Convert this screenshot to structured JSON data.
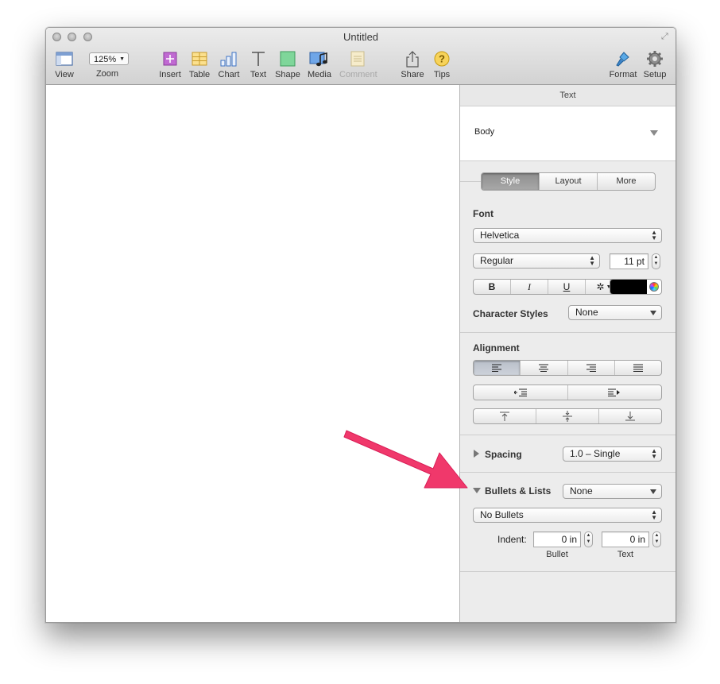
{
  "window": {
    "title": "Untitled"
  },
  "toolbar": {
    "view_label": "View",
    "zoom_value": "125%",
    "zoom_label": "Zoom",
    "insert_label": "Insert",
    "table_label": "Table",
    "chart_label": "Chart",
    "text_label": "Text",
    "shape_label": "Shape",
    "media_label": "Media",
    "comment_label": "Comment",
    "share_label": "Share",
    "tips_label": "Tips",
    "format_label": "Format",
    "setup_label": "Setup"
  },
  "inspector": {
    "header": "Text",
    "paragraph_style": "Body",
    "tabs": [
      {
        "label": "Style",
        "active": true
      },
      {
        "label": "Layout",
        "active": false
      },
      {
        "label": "More",
        "active": false
      }
    ],
    "font": {
      "section_label": "Font",
      "family": "Helvetica",
      "typeface": "Regular",
      "size": "11 pt",
      "bold": "B",
      "italic": "I",
      "underline": "U",
      "text_color": "#000000"
    },
    "character_styles": {
      "label": "Character Styles",
      "value": "None"
    },
    "alignment": {
      "section_label": "Alignment",
      "selected": "left"
    },
    "spacing": {
      "label": "Spacing",
      "value": "1.0 – Single"
    },
    "bullets": {
      "label": "Bullets & Lists",
      "value": "None",
      "type": "No Bullets",
      "indent_label": "Indent:",
      "bullet_indent": "0 in",
      "text_indent": "0 in",
      "bullet_caption": "Bullet",
      "text_caption": "Text"
    }
  },
  "annotation": {
    "color": "#f0386b"
  }
}
